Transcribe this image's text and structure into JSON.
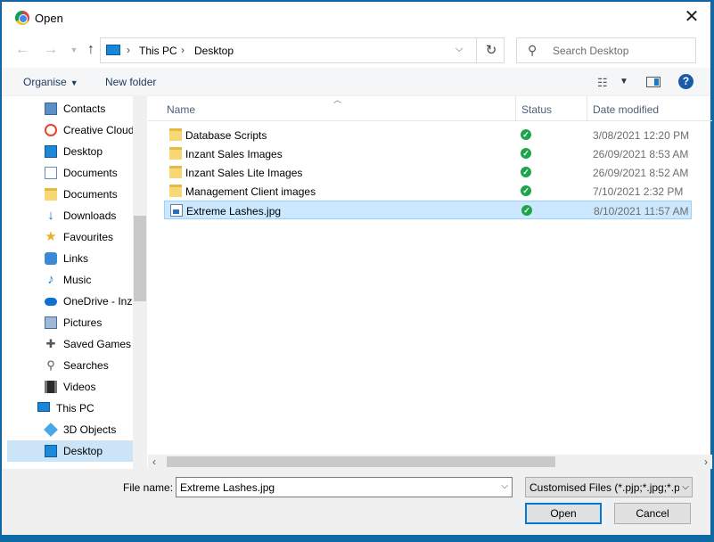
{
  "window": {
    "title": "Open"
  },
  "address": {
    "crumbs": [
      "This PC",
      "Desktop"
    ]
  },
  "search": {
    "placeholder": "Search Desktop"
  },
  "commands": {
    "organise": "Organise",
    "new_folder": "New folder"
  },
  "nav_items": [
    {
      "label": "Contacts",
      "icon": "contacts-icon"
    },
    {
      "label": "Creative Cloud",
      "icon": "creative-cloud-icon"
    },
    {
      "label": "Desktop",
      "icon": "desktop-icon"
    },
    {
      "label": "Documents",
      "icon": "documents-icon"
    },
    {
      "label": "Documents",
      "icon": "folder-icon"
    },
    {
      "label": "Downloads",
      "icon": "downloads-icon"
    },
    {
      "label": "Favourites",
      "icon": "star-icon"
    },
    {
      "label": "Links",
      "icon": "links-icon"
    },
    {
      "label": "Music",
      "icon": "music-icon"
    },
    {
      "label": "OneDrive - Inza",
      "icon": "onedrive-icon"
    },
    {
      "label": "Pictures",
      "icon": "pictures-icon"
    },
    {
      "label": "Saved Games",
      "icon": "saved-games-icon"
    },
    {
      "label": "Searches",
      "icon": "searches-icon"
    },
    {
      "label": "Videos",
      "icon": "videos-icon"
    },
    {
      "label": "This PC",
      "icon": "pc-icon"
    },
    {
      "label": "3D Objects",
      "icon": "3d-objects-icon"
    },
    {
      "label": "Desktop",
      "icon": "desktop-icon"
    }
  ],
  "columns": {
    "name": "Name",
    "status": "Status",
    "date": "Date modified"
  },
  "files": [
    {
      "name": "Database Scripts",
      "date": "3/08/2021 12:20 PM",
      "type": "folder"
    },
    {
      "name": "Inzant Sales Images",
      "date": "26/09/2021 8:53 AM",
      "type": "folder"
    },
    {
      "name": "Inzant Sales Lite Images",
      "date": "26/09/2021 8:52 AM",
      "type": "folder"
    },
    {
      "name": "Management Client images",
      "date": "7/10/2021 2:32 PM",
      "type": "folder"
    },
    {
      "name": "Extreme Lashes.jpg",
      "date": "8/10/2021 11:57 AM",
      "type": "jpg",
      "selected": true
    }
  ],
  "footer": {
    "filename_label": "File name:",
    "filename_value": "Extreme Lashes.jpg",
    "filetype_value": "Customised Files (*.pjp;*.jpg;*.p",
    "open_label": "Open",
    "cancel_label": "Cancel"
  },
  "colors": {
    "accent": "#0078d7",
    "selection": "#cce8ff",
    "status_ok": "#1ea54a",
    "desktop_bg": "#0e6aa6"
  }
}
